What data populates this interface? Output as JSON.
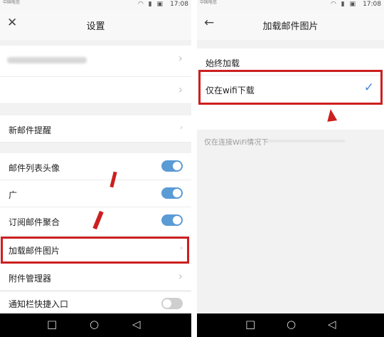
{
  "left": {
    "status": {
      "carrier": "中国电信",
      "time": "17:08"
    },
    "header": {
      "title": "设置"
    },
    "rows": {
      "new_mail": "新邮件提醒",
      "mail_list_avatar": "邮件列表头像",
      "partial_item": "广",
      "subscription": "订阅邮件聚合",
      "load_images": "加载邮件图片",
      "attachment_manager": "附件管理器",
      "notification_shortcut": "通知栏快捷入口"
    },
    "toggles": {
      "mail_list_avatar": "on",
      "partial_item": "on",
      "subscription": "on",
      "notification_shortcut": "off"
    }
  },
  "right": {
    "status": {
      "carrier": "中国电信",
      "time": "17:08"
    },
    "header": {
      "title": "加载邮件图片"
    },
    "options": {
      "always": "始终加载",
      "wifi_only": "仅在wifi下载"
    },
    "selected": "wifi_only",
    "hint": "仅在连接WiFi情况下"
  },
  "accent_color": "#5b9bd5",
  "highlight_color": "#cc1f1f"
}
